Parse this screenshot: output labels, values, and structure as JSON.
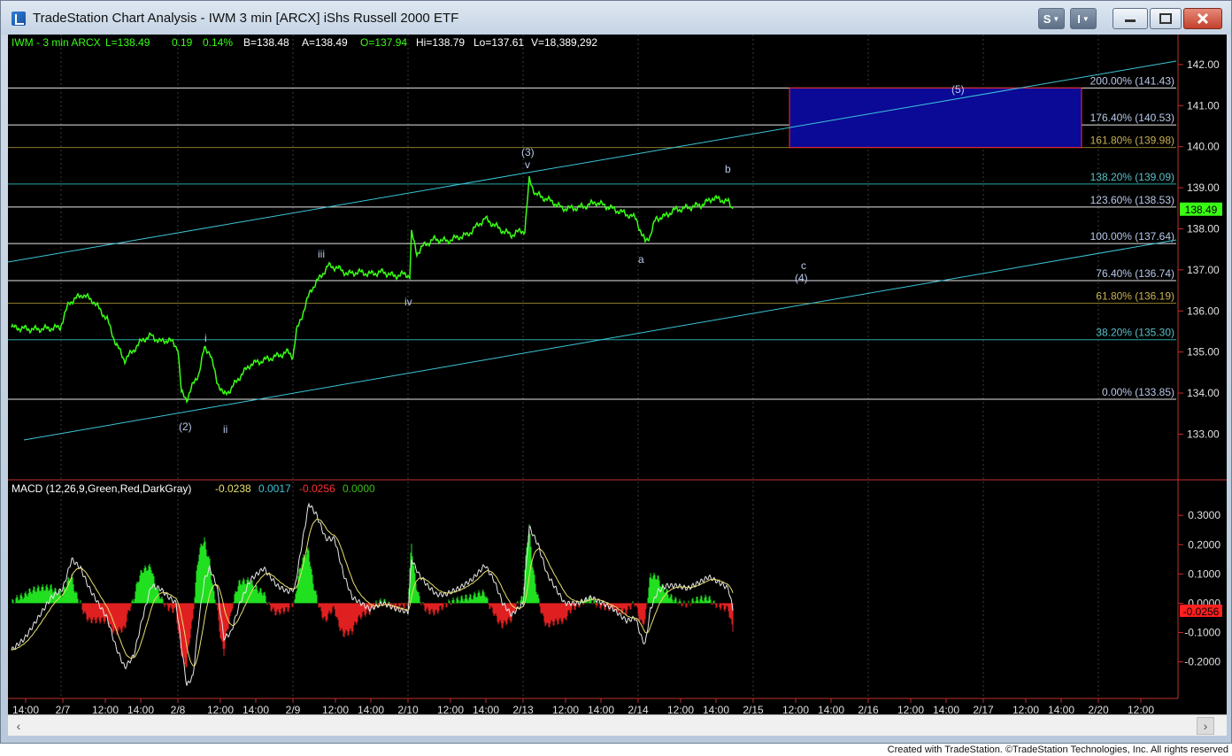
{
  "window": {
    "title": "TradeStation Chart Analysis - IWM 3 min [ARCX] iShs Russell 2000 ETF",
    "btn_s": "S",
    "btn_i": "I",
    "min_icon": "minimize-icon",
    "max_icon": "maximize-icon",
    "close_icon": "close-icon"
  },
  "header": {
    "symbol": "IWM - 3 min  ARCX",
    "last": "L=138.49",
    "change": "0.19",
    "pct": "0.14%",
    "bid": "B=138.48",
    "ask": "A=138.49",
    "open": "O=137.94",
    "high": "Hi=138.79",
    "low": "Lo=137.61",
    "volume": "V=18,389,292"
  },
  "macd_header": {
    "label": "MACD (12,26,9,Green,Red,DarkGray)",
    "v1": "-0.0238",
    "v2": "0.0017",
    "v3": "-0.0256",
    "v4": "0.0000"
  },
  "colors": {
    "price": "#39ff14",
    "fib_white": "#e6e6e6",
    "fib_olive": "#8a7a2a",
    "fib_teal": "#2aa6a6",
    "trend": "#3cc6d8",
    "box_fill": "#0a0a96",
    "box_border": "#ff2a2a",
    "label": "#b8c8e8",
    "last_price_bg": "#39ff14"
  },
  "chart_data": [
    {
      "type": "line",
      "title": "IWM - 3 min",
      "ylim": [
        132.6,
        142.3
      ],
      "y_ticks": [
        "142.00",
        "141.00",
        "140.00",
        "139.00",
        "138.00",
        "137.00",
        "136.00",
        "135.00",
        "134.00",
        "133.00"
      ],
      "last_price_label": "138.49",
      "x_ticks": [
        "14:00",
        "2/7",
        "12:00",
        "14:00",
        "2/8",
        "12:00",
        "14:00",
        "2/9",
        "12:00",
        "14:00",
        "2/10",
        "12:00",
        "14:00",
        "2/13",
        "12:00",
        "14:00",
        "2/14",
        "12:00",
        "14:00",
        "2/15",
        "12:00",
        "14:00",
        "2/16",
        "12:00",
        "14:00",
        "2/17",
        "12:00",
        "14:00",
        "2/20",
        "12:00"
      ],
      "fib_levels": [
        {
          "label": "200.00%",
          "value_label": "(141.43)",
          "value": 141.43,
          "style": "white"
        },
        {
          "label": "176.40%",
          "value_label": "(140.53)",
          "value": 140.53,
          "style": "white"
        },
        {
          "label": "161.80%",
          "value_label": "(139.98)",
          "value": 139.98,
          "style": "olive"
        },
        {
          "label": "138.20%",
          "value_label": "(139.09)",
          "value": 139.09,
          "style": "teal"
        },
        {
          "label": "123.60%",
          "value_label": "(138.53)",
          "value": 138.53,
          "style": "white"
        },
        {
          "label": "100.00%",
          "value_label": "(137.64)",
          "value": 137.64,
          "style": "white"
        },
        {
          "label": "76.40%",
          "value_label": "(136.74)",
          "value": 136.74,
          "style": "white"
        },
        {
          "label": "61.80%",
          "value_label": "(136.19)",
          "value": 136.19,
          "style": "olive"
        },
        {
          "label": "38.20%",
          "value_label": "(135.30)",
          "value": 135.3,
          "style": "teal"
        },
        {
          "label": "0.00%",
          "value_label": "(133.85)",
          "value": 133.85,
          "style": "white"
        }
      ],
      "target_box": {
        "price_top": 141.43,
        "price_bottom": 139.98
      },
      "wave_labels": [
        "(5)",
        "(3)",
        "v",
        "b",
        "iii",
        "a",
        "c",
        "(4)",
        "iv",
        "i",
        "(2)",
        "ii"
      ],
      "series": [
        {
          "values": [
            [
              0,
              135.6
            ],
            [
              25,
              135.55
            ],
            [
              55,
              135.6
            ],
            [
              65,
              136.2
            ],
            [
              80,
              136.4
            ],
            [
              92,
              136.25
            ],
            [
              108,
              135.8
            ],
            [
              118,
              135.2
            ],
            [
              128,
              134.8
            ],
            [
              138,
              135.05
            ],
            [
              148,
              135.3
            ],
            [
              158,
              135.4
            ],
            [
              168,
              135.25
            ],
            [
              178,
              135.3
            ],
            [
              188,
              135.1
            ],
            [
              192,
              134.0
            ],
            [
              198,
              133.85
            ],
            [
              205,
              134.2
            ],
            [
              212,
              134.5
            ],
            [
              218,
              135.1
            ],
            [
              224,
              135.0
            ],
            [
              232,
              134.3
            ],
            [
              240,
              133.95
            ],
            [
              248,
              134.1
            ],
            [
              258,
              134.4
            ],
            [
              270,
              134.7
            ],
            [
              285,
              134.8
            ],
            [
              300,
              134.9
            ],
            [
              312,
              135.0
            ],
            [
              318,
              134.9
            ],
            [
              322,
              135.5
            ],
            [
              330,
              136.0
            ],
            [
              338,
              136.5
            ],
            [
              348,
              136.8
            ],
            [
              358,
              137.1
            ],
            [
              368,
              137.05
            ],
            [
              380,
              136.9
            ],
            [
              392,
              136.95
            ],
            [
              405,
              136.9
            ],
            [
              420,
              136.95
            ],
            [
              432,
              136.85
            ],
            [
              445,
              136.9
            ],
            [
              450,
              136.85
            ],
            [
              452,
              137.9
            ],
            [
              458,
              137.4
            ],
            [
              466,
              137.6
            ],
            [
              478,
              137.75
            ],
            [
              492,
              137.7
            ],
            [
              505,
              137.8
            ],
            [
              515,
              137.85
            ],
            [
              525,
              138.05
            ],
            [
              535,
              138.25
            ],
            [
              545,
              138.1
            ],
            [
              555,
              137.95
            ],
            [
              565,
              137.85
            ],
            [
              575,
              137.95
            ],
            [
              580,
              137.95
            ],
            [
              585,
              139.2
            ],
            [
              592,
              138.85
            ],
            [
              602,
              138.75
            ],
            [
              612,
              138.65
            ],
            [
              622,
              138.5
            ],
            [
              635,
              138.5
            ],
            [
              648,
              138.55
            ],
            [
              660,
              138.65
            ],
            [
              672,
              138.55
            ],
            [
              684,
              138.45
            ],
            [
              696,
              138.35
            ],
            [
              706,
              138.25
            ],
            [
              712,
              137.85
            ],
            [
              716,
              137.7
            ],
            [
              722,
              137.85
            ],
            [
              728,
              138.25
            ],
            [
              738,
              138.3
            ],
            [
              748,
              138.45
            ],
            [
              760,
              138.5
            ],
            [
              772,
              138.55
            ],
            [
              782,
              138.6
            ],
            [
              792,
              138.75
            ],
            [
              803,
              138.7
            ],
            [
              810,
              138.65
            ],
            [
              815,
              138.49
            ]
          ]
        }
      ]
    },
    {
      "type": "line",
      "title": "MACD (12,26,9,Green,Red,DarkGray)",
      "ylim": [
        -0.31,
        0.37
      ],
      "y_ticks": [
        "0.3000",
        "0.2000",
        "0.1000",
        "0.0000",
        "-0.1000",
        "-0.2000"
      ],
      "last_value_label": "-0.0256",
      "series": [
        {
          "name": "MACD",
          "values": [
            [
              0,
              -0.16
            ],
            [
              15,
              -0.12
            ],
            [
              30,
              -0.05
            ],
            [
              45,
              0.02
            ],
            [
              58,
              0.05
            ],
            [
              68,
              0.15
            ],
            [
              78,
              0.12
            ],
            [
              88,
              0.05
            ],
            [
              98,
              0.0
            ],
            [
              108,
              -0.05
            ],
            [
              118,
              -0.15
            ],
            [
              128,
              -0.22
            ],
            [
              138,
              -0.18
            ],
            [
              148,
              -0.05
            ],
            [
              158,
              0.06
            ],
            [
              168,
              0.05
            ],
            [
              178,
              0.02
            ],
            [
              186,
              0.0
            ],
            [
              192,
              -0.15
            ],
            [
              198,
              -0.28
            ],
            [
              205,
              -0.25
            ],
            [
              212,
              -0.05
            ],
            [
              218,
              0.08
            ],
            [
              224,
              0.12
            ],
            [
              232,
              0.06
            ],
            [
              240,
              -0.12
            ],
            [
              248,
              -0.1
            ],
            [
              258,
              0.0
            ],
            [
              270,
              0.08
            ],
            [
              285,
              0.12
            ],
            [
              300,
              0.06
            ],
            [
              312,
              0.04
            ],
            [
              320,
              0.05
            ],
            [
              328,
              0.2
            ],
            [
              336,
              0.34
            ],
            [
              345,
              0.3
            ],
            [
              355,
              0.22
            ],
            [
              365,
              0.22
            ],
            [
              375,
              0.1
            ],
            [
              385,
              0.02
            ],
            [
              395,
              0.0
            ],
            [
              405,
              -0.02
            ],
            [
              420,
              0.0
            ],
            [
              435,
              -0.02
            ],
            [
              448,
              -0.03
            ],
            [
              452,
              0.15
            ],
            [
              460,
              0.1
            ],
            [
              470,
              0.06
            ],
            [
              480,
              0.03
            ],
            [
              490,
              0.03
            ],
            [
              505,
              0.05
            ],
            [
              520,
              0.08
            ],
            [
              535,
              0.13
            ],
            [
              545,
              0.08
            ],
            [
              555,
              0.0
            ],
            [
              565,
              -0.04
            ],
            [
              578,
              0.0
            ],
            [
              585,
              0.26
            ],
            [
              595,
              0.2
            ],
            [
              605,
              0.1
            ],
            [
              615,
              0.05
            ],
            [
              625,
              0.0
            ],
            [
              640,
              0.0
            ],
            [
              655,
              0.02
            ],
            [
              668,
              0.0
            ],
            [
              680,
              -0.02
            ],
            [
              695,
              -0.06
            ],
            [
              705,
              -0.05
            ],
            [
              712,
              -0.12
            ],
            [
              716,
              -0.14
            ],
            [
              722,
              -0.02
            ],
            [
              730,
              0.04
            ],
            [
              740,
              0.06
            ],
            [
              752,
              0.06
            ],
            [
              764,
              0.05
            ],
            [
              776,
              0.07
            ],
            [
              788,
              0.09
            ],
            [
              800,
              0.07
            ],
            [
              810,
              0.05
            ],
            [
              815,
              -0.02
            ]
          ]
        }
      ]
    }
  ]
}
